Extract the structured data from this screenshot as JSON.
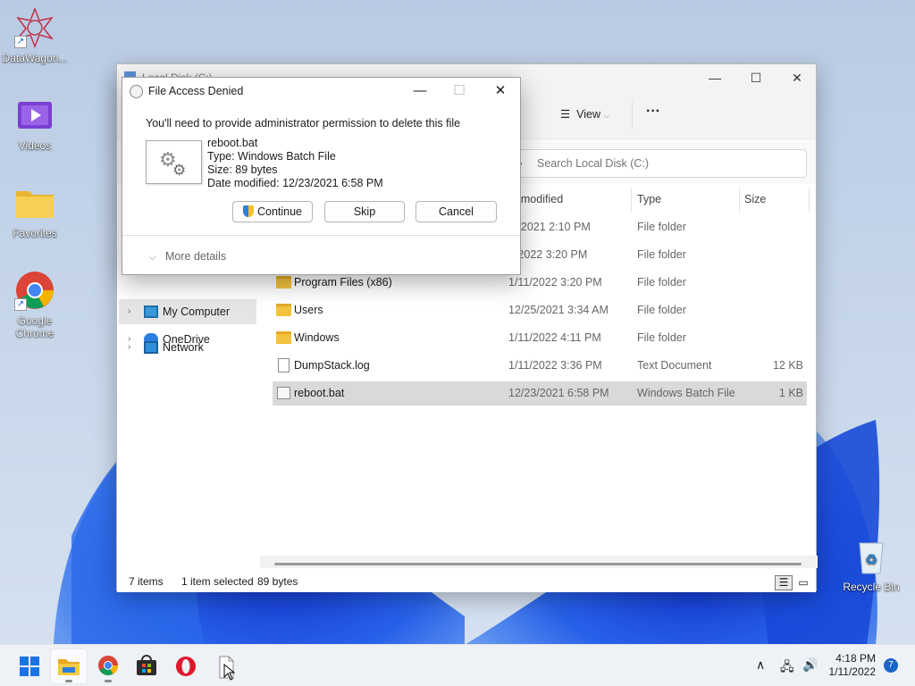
{
  "desktop": {
    "icons": [
      {
        "label": "DataWagon...",
        "icon": "datawagon-icon"
      },
      {
        "label": "Videos",
        "icon": "videos-folder-icon"
      },
      {
        "label": "Favorites",
        "icon": "folder-icon"
      },
      {
        "label": "Google Chrome",
        "icon": "chrome-icon"
      },
      {
        "label": "Recycle Bin",
        "icon": "recycle-bin-icon"
      }
    ]
  },
  "explorer": {
    "title": "Local Disk (C:)",
    "toolbar": {
      "sort_partial": "t",
      "view_label": "View",
      "more": "···"
    },
    "search_placeholder": "Search Local Disk (C:)",
    "nav": [
      {
        "label": "OneDrive",
        "icon": "cloud-icon"
      },
      {
        "label": "My Computer",
        "icon": "monitor-icon"
      },
      {
        "label": "Network",
        "icon": "network-icon"
      }
    ],
    "columns": {
      "date": "te modified",
      "type": "Type",
      "size": "Size"
    },
    "rows": [
      {
        "name": "",
        "date": "/6/2021 2:10 PM",
        "type": "File folder",
        "size": "",
        "kind": "folder"
      },
      {
        "name": "",
        "date": "1/2022 3:20 PM",
        "type": "File folder",
        "size": "",
        "kind": "folder"
      },
      {
        "name": "Program Files (x86)",
        "date": "1/11/2022 3:20 PM",
        "type": "File folder",
        "size": "",
        "kind": "folder"
      },
      {
        "name": "Users",
        "date": "12/25/2021 3:34 AM",
        "type": "File folder",
        "size": "",
        "kind": "folder"
      },
      {
        "name": "Windows",
        "date": "1/11/2022 4:11 PM",
        "type": "File folder",
        "size": "",
        "kind": "folder"
      },
      {
        "name": "DumpStack.log",
        "date": "1/11/2022 3:36 PM",
        "type": "Text Document",
        "size": "12 KB",
        "kind": "doc"
      },
      {
        "name": "reboot.bat",
        "date": "12/23/2021 6:58 PM",
        "type": "Windows Batch File",
        "size": "1 KB",
        "kind": "bat",
        "selected": true
      }
    ],
    "status": {
      "items": "7 items",
      "selected": "1 item selected",
      "size": "89 bytes"
    }
  },
  "dialog": {
    "title": "File Access Denied",
    "message": "You'll need to provide administrator permission to delete this file",
    "file_name": "reboot.bat",
    "file_type": "Type: Windows Batch File",
    "file_size": "Size: 89 bytes",
    "file_date": "Date modified: 12/23/2021 6:58 PM",
    "buttons": {
      "continue": "Continue",
      "skip": "Skip",
      "cancel": "Cancel"
    },
    "more_details": "More details"
  },
  "taskbar": {
    "apps": [
      "start-icon",
      "file-explorer-icon",
      "chrome-icon",
      "store-icon",
      "opera-icon",
      "document-icon"
    ],
    "time": "4:18 PM",
    "date": "1/11/2022",
    "notifications": "7"
  }
}
